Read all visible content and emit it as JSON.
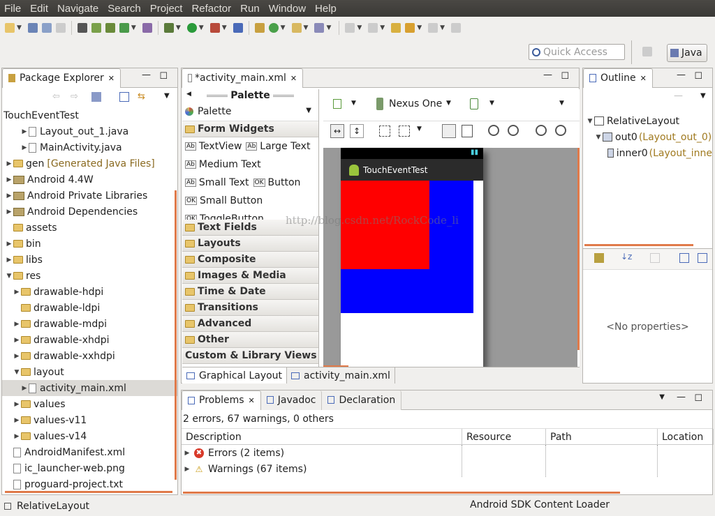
{
  "menu": [
    "File",
    "Edit",
    "Navigate",
    "Search",
    "Project",
    "Refactor",
    "Run",
    "Window",
    "Help"
  ],
  "quick_access": {
    "placeholder": "Quick Access"
  },
  "perspective": {
    "label": "Java"
  },
  "package_explorer": {
    "tab": "Package Explorer",
    "project": "TouchEventTest",
    "items": [
      {
        "label": "Layout_out_1.java",
        "indent": 2,
        "kind": "java"
      },
      {
        "label": "MainActivity.java",
        "indent": 2,
        "kind": "java"
      },
      {
        "label": "gen",
        "suffix": "[Generated Java Files]",
        "indent": 0,
        "kind": "folder"
      },
      {
        "label": "Android 4.4W",
        "indent": 0,
        "kind": "jar"
      },
      {
        "label": "Android Private Libraries",
        "indent": 0,
        "kind": "jar"
      },
      {
        "label": "Android Dependencies",
        "indent": 0,
        "kind": "jar"
      },
      {
        "label": "assets",
        "indent": 0,
        "kind": "folder-noarrow"
      },
      {
        "label": "bin",
        "indent": 0,
        "kind": "folder"
      },
      {
        "label": "libs",
        "indent": 0,
        "kind": "folder"
      },
      {
        "label": "res",
        "indent": 0,
        "kind": "folder-open"
      },
      {
        "label": "drawable-hdpi",
        "indent": 1,
        "kind": "folder"
      },
      {
        "label": "drawable-ldpi",
        "indent": 1,
        "kind": "folder-noarrow"
      },
      {
        "label": "drawable-mdpi",
        "indent": 1,
        "kind": "folder"
      },
      {
        "label": "drawable-xhdpi",
        "indent": 1,
        "kind": "folder"
      },
      {
        "label": "drawable-xxhdpi",
        "indent": 1,
        "kind": "folder"
      },
      {
        "label": "layout",
        "indent": 1,
        "kind": "folder-open"
      },
      {
        "label": "activity_main.xml",
        "indent": 2,
        "kind": "xml",
        "selected": true
      },
      {
        "label": "values",
        "indent": 1,
        "kind": "folder"
      },
      {
        "label": "values-v11",
        "indent": 1,
        "kind": "folder"
      },
      {
        "label": "values-v14",
        "indent": 1,
        "kind": "folder"
      },
      {
        "label": "AndroidManifest.xml",
        "indent": 0,
        "kind": "xml-noarrow"
      },
      {
        "label": "ic_launcher-web.png",
        "indent": 0,
        "kind": "file"
      },
      {
        "label": "proguard-project.txt",
        "indent": 0,
        "kind": "file"
      }
    ]
  },
  "editor": {
    "tab": "*activity_main.xml",
    "palette_header": "Palette",
    "palette_dropdown": "Palette",
    "device": "Nexus One",
    "form_widgets": {
      "title": "Form Widgets",
      "rows": [
        [
          "TextView",
          "Large Text"
        ],
        [
          "Medium Text"
        ],
        [
          "Small Text",
          "Button"
        ],
        [
          "Small Button"
        ],
        [
          "ToggleButton"
        ]
      ]
    },
    "categories": [
      "Text Fields",
      "Layouts",
      "Composite",
      "Images & Media",
      "Time & Date",
      "Transitions",
      "Advanced",
      "Other",
      "Custom & Library Views"
    ],
    "app_title": "TouchEventTest",
    "watermark": "http://blog.csdn.net/RockCode_li",
    "bottom_tabs": [
      "Graphical Layout",
      "activity_main.xml"
    ],
    "colors": {
      "red": "#ff0000",
      "blue": "#0000ff",
      "actionbar": "#2b2b2b"
    }
  },
  "outline": {
    "tab": "Outline",
    "nodes": [
      {
        "label": "RelativeLayout",
        "extra": "",
        "indent": 0
      },
      {
        "label": "out0",
        "extra": "(Layout_out_0)",
        "indent": 1
      },
      {
        "label": "inner0",
        "extra": "(Layout_inne",
        "indent": 2
      }
    ],
    "no_properties": "<No properties>"
  },
  "problems": {
    "tabs": [
      "Problems",
      "Javadoc",
      "Declaration"
    ],
    "summary": "2 errors, 67 warnings, 0 others",
    "columns": [
      "Description",
      "Resource",
      "Path",
      "Location"
    ],
    "rows": [
      {
        "label": "Errors (2 items)",
        "type": "error"
      },
      {
        "label": "Warnings (67 items)",
        "type": "warning"
      }
    ]
  },
  "status": {
    "left": "RelativeLayout",
    "right": "Android SDK Content Loader"
  }
}
